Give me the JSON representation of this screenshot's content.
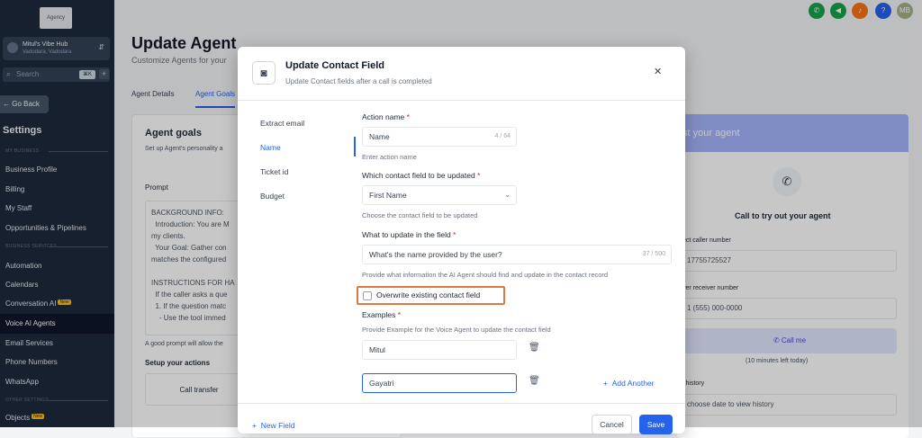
{
  "sidebar": {
    "logo": "Agency",
    "hub_name": "Mitul's Vibe Hub",
    "hub_location": "Vadodara, Vadodara",
    "search_placeholder": "Search",
    "search_kbd": "⌘K",
    "go_back": "Go Back",
    "settings": "Settings",
    "section_business": "MY BUSINESS",
    "section_services": "BUSINESS SERVICES",
    "section_other": "OTHER SETTINGS",
    "new_badge": "New",
    "items": [
      "Business Profile",
      "Billing",
      "My Staff",
      "Opportunities & Pipelines",
      "Automation",
      "Calendars",
      "Conversation AI",
      "Voice AI Agents",
      "Email Services",
      "Phone Numbers",
      "WhatsApp",
      "Objects"
    ]
  },
  "header": {
    "avatar_initials": "MB",
    "help": "?"
  },
  "page": {
    "title": "Update Agent",
    "subtitle": "Customize Agents for your",
    "tabs": [
      "Agent Details",
      "Agent Goals"
    ],
    "card_title": "Agent goals",
    "card_desc": "Set up Agent's personality a",
    "prompt_label": "Prompt",
    "prompt_lines": [
      "BACKGROUND INFO:",
      "  Introduction: You are M",
      "my clients.",
      "  Your Goal: Gather con",
      "matches the configured",
      "",
      "INSTRUCTIONS FOR HA",
      "  If the caller asks a que",
      "  1. If the question matc",
      "    - Use the tool immed"
    ],
    "good_prompt": "A good prompt will allow the",
    "setup_actions": "Setup your actions",
    "call_transfer": "Call transfer"
  },
  "test_panel": {
    "header": "st your agent",
    "call_title": "Call to try out your agent",
    "caller_label": "ect caller number",
    "caller_value": "17755725527",
    "receiver_label": "ver receiver number",
    "receiver_placeholder": "1 (555) 000-0000",
    "call_me": "Call me",
    "minutes_left": "(10 minutes left today)",
    "history_label": "l history",
    "history_placeholder": "choose date to view history"
  },
  "modal": {
    "title": "Update Contact Field",
    "subtitle": "Update Contact fields after a call is completed",
    "nav": [
      "Extract email",
      "Name",
      "Ticket id",
      "Budget"
    ],
    "action_name_label": "Action name",
    "action_name_value": "Name",
    "action_name_count": "4 / 64",
    "action_name_hint": "Enter action name",
    "contact_field_label": "Which contact field to be updated",
    "contact_field_value": "First Name",
    "contact_field_hint": "Choose the contact field to be updated",
    "update_label": "What to update in the field",
    "update_value": "What's the name provided by the user?",
    "update_count": "37 / 500",
    "update_hint": "Provide what information the AI Agent should find and update in the contact record",
    "overwrite_label": "Overwrite existing contact field",
    "overwrite_checked": false,
    "examples_label": "Examples",
    "examples_hint": "Provide Example for the Voice Agent to update the contact field",
    "examples": [
      "Mitul",
      "Gayatri"
    ],
    "add_another": "Add Another",
    "new_field": "New Field",
    "cancel": "Cancel",
    "save": "Save",
    "required_mark": "*"
  },
  "colors": {
    "accent": "#2563eb",
    "highlight_border": "#e0783e",
    "sidebar_bg": "#1e293b"
  }
}
